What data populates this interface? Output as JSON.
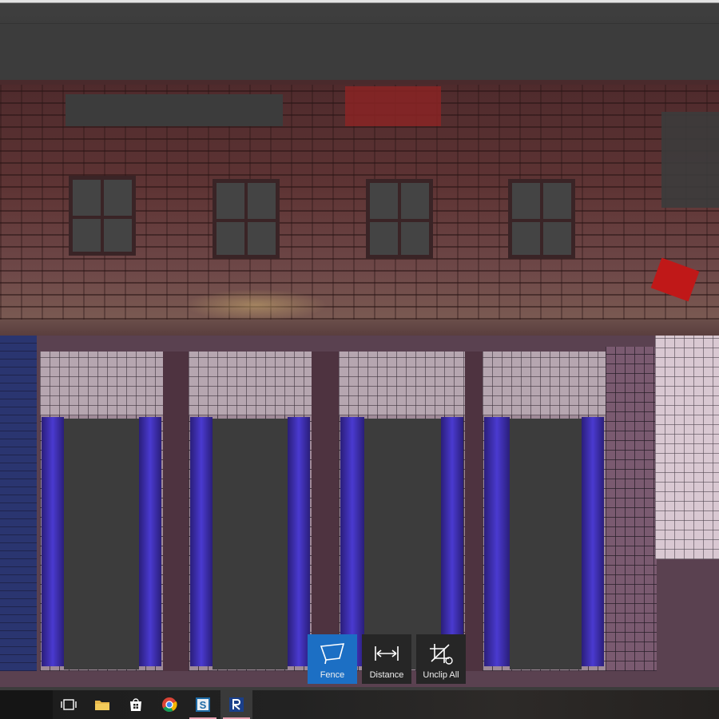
{
  "toolbar": {
    "tools": [
      {
        "label": "Fence",
        "icon": "fence-icon",
        "active": true
      },
      {
        "label": "Distance",
        "icon": "distance-icon",
        "active": false
      },
      {
        "label": "Unclip All",
        "icon": "unclip-all-icon",
        "active": false
      }
    ]
  },
  "taskbar": {
    "items": [
      {
        "icon": "task-view-icon"
      },
      {
        "icon": "file-explorer-icon"
      },
      {
        "icon": "store-icon"
      },
      {
        "icon": "chrome-icon"
      },
      {
        "icon": "app-s-icon"
      },
      {
        "icon": "recap-app-icon"
      }
    ]
  },
  "colors": {
    "active_tool": "#1c6fc4",
    "tool_bg": "#262626",
    "viewport_bg": "#3c3c3c"
  }
}
